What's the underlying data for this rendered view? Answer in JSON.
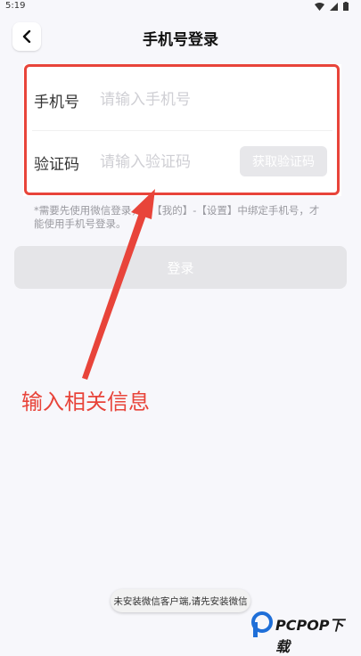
{
  "status_bar": {
    "time": "5:19"
  },
  "header": {
    "title": "手机号登录"
  },
  "form": {
    "phone_label": "手机号",
    "phone_placeholder": "请输入手机号",
    "code_label": "验证码",
    "code_placeholder": "请输入验证码",
    "get_code_button": "获取验证码"
  },
  "notice": "*需要先使用微信登录，在【我的】-【设置】中绑定手机号，才能使用手机号登录。",
  "login_button": "登录",
  "annotation": "输入相关信息",
  "toast": "未安装微信客户端,请先安装微信",
  "watermark": "PCPOP下载",
  "colors": {
    "annotation": "#e8443a",
    "disabled": "#e5e5e8"
  }
}
